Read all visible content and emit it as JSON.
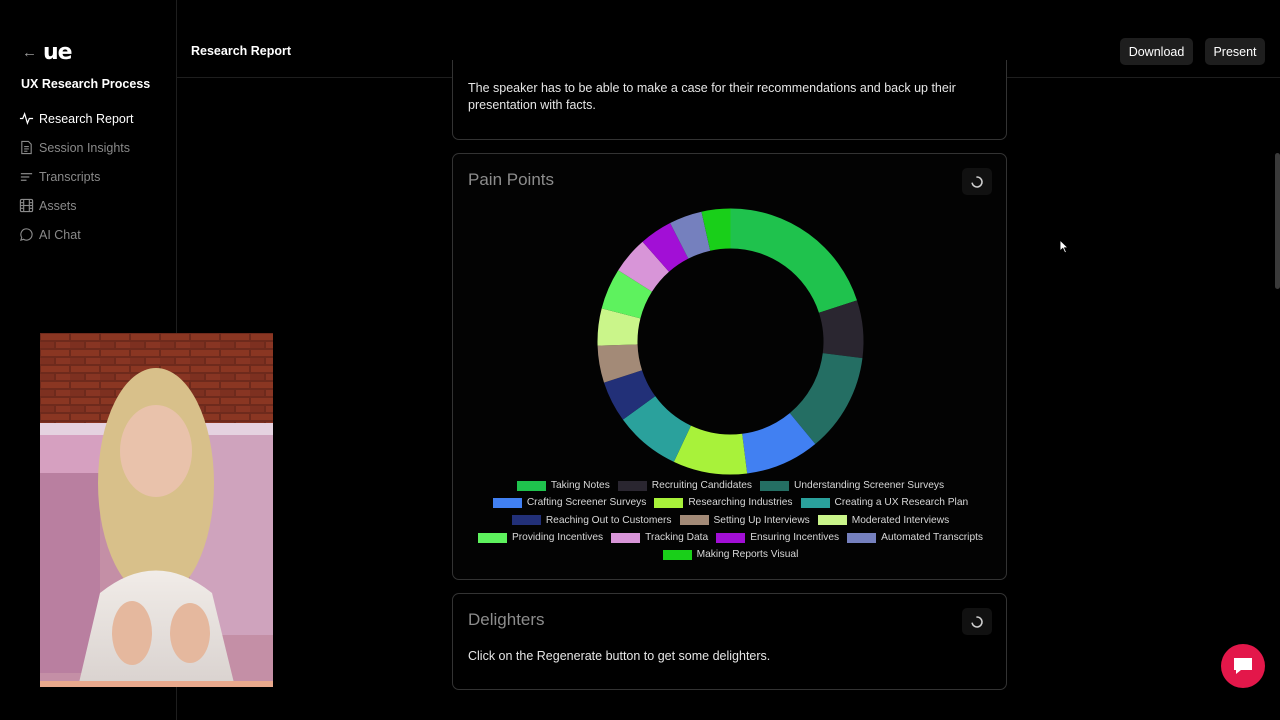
{
  "app": {
    "logo": "ue",
    "project_title": "UX Research Process"
  },
  "sidebar": {
    "items": [
      {
        "label": "Research Report",
        "icon": "activity-icon",
        "active": true
      },
      {
        "label": "Session Insights",
        "icon": "document-icon",
        "active": false
      },
      {
        "label": "Transcripts",
        "icon": "lines-icon",
        "active": false
      },
      {
        "label": "Assets",
        "icon": "film-icon",
        "active": false
      },
      {
        "label": "AI Chat",
        "icon": "chat-icon",
        "active": false
      }
    ]
  },
  "header": {
    "title": "Research Report",
    "download_label": "Download",
    "present_label": "Present"
  },
  "sections": {
    "intro_text": "The speaker has to be able to make a case for their recommendations and back up their presentation with facts.",
    "pain_points_title": "Pain Points",
    "delighters_title": "Delighters",
    "delighters_text": "Click on the Regenerate button to get some delighters."
  },
  "chart_data": {
    "type": "pie",
    "title": "Pain Points",
    "categories": [
      "Taking Notes",
      "Recruiting Candidates",
      "Understanding Screener Surveys",
      "Crafting Screener Surveys",
      "Researching Industries",
      "Creating a UX Research Plan",
      "Reaching Out to Customers",
      "Setting Up Interviews",
      "Moderated Interviews",
      "Providing Incentives",
      "Tracking Data",
      "Ensuring Incentives",
      "Automated Transcripts",
      "Making Reports Visual"
    ],
    "values": [
      20,
      7,
      12,
      9,
      9,
      8,
      5,
      4.5,
      4.5,
      5,
      4.5,
      4,
      4,
      3.5
    ],
    "colors": [
      "#1fc24d",
      "#2a2630",
      "#246e63",
      "#4180f2",
      "#a8f23a",
      "#2aa19c",
      "#223078",
      "#a38a77",
      "#caf58a",
      "#5ef25e",
      "#d895d8",
      "#a20fd6",
      "#7580be",
      "#19cf19"
    ],
    "legend_position": "bottom"
  },
  "colors": {
    "accent": "#e3174a",
    "button_bg": "#1e1e1e",
    "border": "#333333"
  }
}
